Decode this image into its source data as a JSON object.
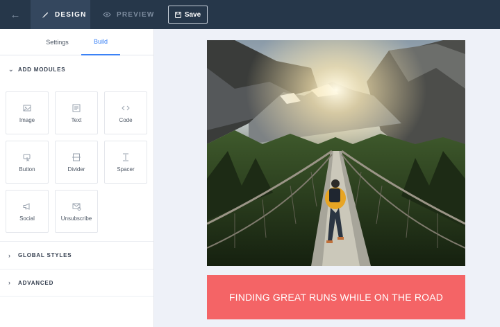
{
  "topbar": {
    "back_icon": "arrow-left-icon",
    "design_label": "DESIGN",
    "preview_label": "PREVIEW",
    "save_label": "Save",
    "colors": {
      "bar": "#26374a",
      "active_tab": "#34475e"
    }
  },
  "sidebar": {
    "tabs": [
      "Settings",
      "Build"
    ],
    "active_tab": "Build",
    "sections": {
      "add_modules": "ADD MODULES",
      "global_styles": "GLOBAL STYLES",
      "advanced": "ADVANCED"
    },
    "modules": [
      {
        "label": "Image",
        "icon": "image-icon"
      },
      {
        "label": "Text",
        "icon": "text-icon"
      },
      {
        "label": "Code",
        "icon": "code-icon"
      },
      {
        "label": "Button",
        "icon": "button-icon"
      },
      {
        "label": "Divider",
        "icon": "divider-icon"
      },
      {
        "label": "Spacer",
        "icon": "spacer-icon"
      },
      {
        "label": "Social",
        "icon": "megaphone-icon"
      },
      {
        "label": "Unsubscribe",
        "icon": "unsubscribe-icon"
      }
    ]
  },
  "canvas": {
    "banner_text": "FINDING GREAT RUNS WHILE ON THE ROAD",
    "banner_color": "#f46466"
  }
}
